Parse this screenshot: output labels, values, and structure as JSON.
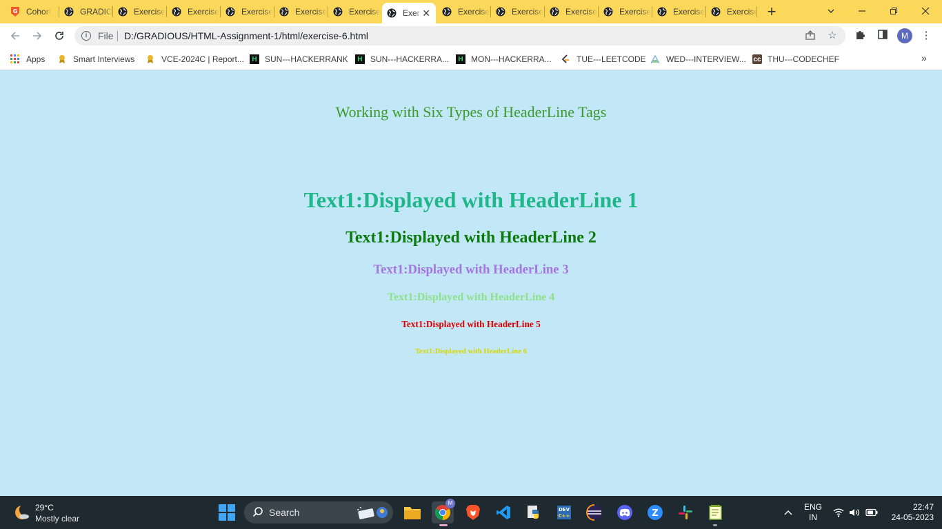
{
  "browser": {
    "tabs": [
      {
        "title": "Cohort",
        "icon": "gradious-shield-icon"
      },
      {
        "title": "GRADIOUS",
        "icon": "globe-icon"
      },
      {
        "title": "Exercise",
        "icon": "globe-icon"
      },
      {
        "title": "Exercise",
        "icon": "globe-icon"
      },
      {
        "title": "Exercise",
        "icon": "globe-icon"
      },
      {
        "title": "Exercise",
        "icon": "globe-icon"
      },
      {
        "title": "Exercise",
        "icon": "globe-icon"
      },
      {
        "title": "Exercise",
        "icon": "globe-icon",
        "active": true
      },
      {
        "title": "Exercise",
        "icon": "globe-icon"
      },
      {
        "title": "Exercise",
        "icon": "globe-icon"
      },
      {
        "title": "Exercise",
        "icon": "globe-icon"
      },
      {
        "title": "Exercise",
        "icon": "globe-icon"
      },
      {
        "title": "Exercise",
        "icon": "globe-icon"
      },
      {
        "title": "Exercise",
        "icon": "globe-icon"
      }
    ],
    "tab_strip_color": "#fbd85a",
    "omnibox": {
      "scheme_label": "File",
      "url": "D:/GRADIOUS/HTML-Assignment-1/html/exercise-6.html"
    },
    "profile_initial": "M",
    "bookmarks": [
      {
        "label": "Apps",
        "icon": "apps-grid-icon"
      },
      {
        "label": "Smart Interviews",
        "icon": "smart-interviews-icon"
      },
      {
        "label": "VCE-2024C | Report...",
        "icon": "smart-interviews-icon"
      },
      {
        "label": "SUN---HACKERRANK",
        "icon": "hackerrank-icon"
      },
      {
        "label": "SUN---HACKERRA...",
        "icon": "hackerrank-icon"
      },
      {
        "label": "MON---HACKERRA...",
        "icon": "hackerrank-icon"
      },
      {
        "label": "TUE---LEETCODE",
        "icon": "leetcode-icon"
      },
      {
        "label": "WED---INTERVIEW...",
        "icon": "interviewbit-icon"
      },
      {
        "label": "THU---CODECHEF",
        "icon": "codechef-icon"
      }
    ]
  },
  "page": {
    "background": "#c2e8f7",
    "title": "Working with Six Types of HeaderLine Tags",
    "headers": [
      {
        "text": "Text1:Displayed with HeaderLine 1",
        "color": "#20b68a"
      },
      {
        "text": "Text1:Displayed with HeaderLine 2",
        "color": "#0d7a0d"
      },
      {
        "text": "Text1:Displayed with HeaderLine 3",
        "color": "#a575e2"
      },
      {
        "text": "Text1:Displayed with HeaderLine 4",
        "color": "#8fe08a"
      },
      {
        "text": "Text1:Displayed with HeaderLine 5",
        "color": "#dd0000"
      },
      {
        "text": "Text1:Displayed with HeaderLine 6",
        "color": "#d7d700"
      }
    ]
  },
  "taskbar": {
    "weather": {
      "temp": "29°C",
      "condition": "Mostly clear"
    },
    "search_label": "Search",
    "language": {
      "line1": "ENG",
      "line2": "IN"
    },
    "clock": {
      "time": "22:47",
      "date": "24-05-2023"
    },
    "chrome_badge": "M"
  }
}
